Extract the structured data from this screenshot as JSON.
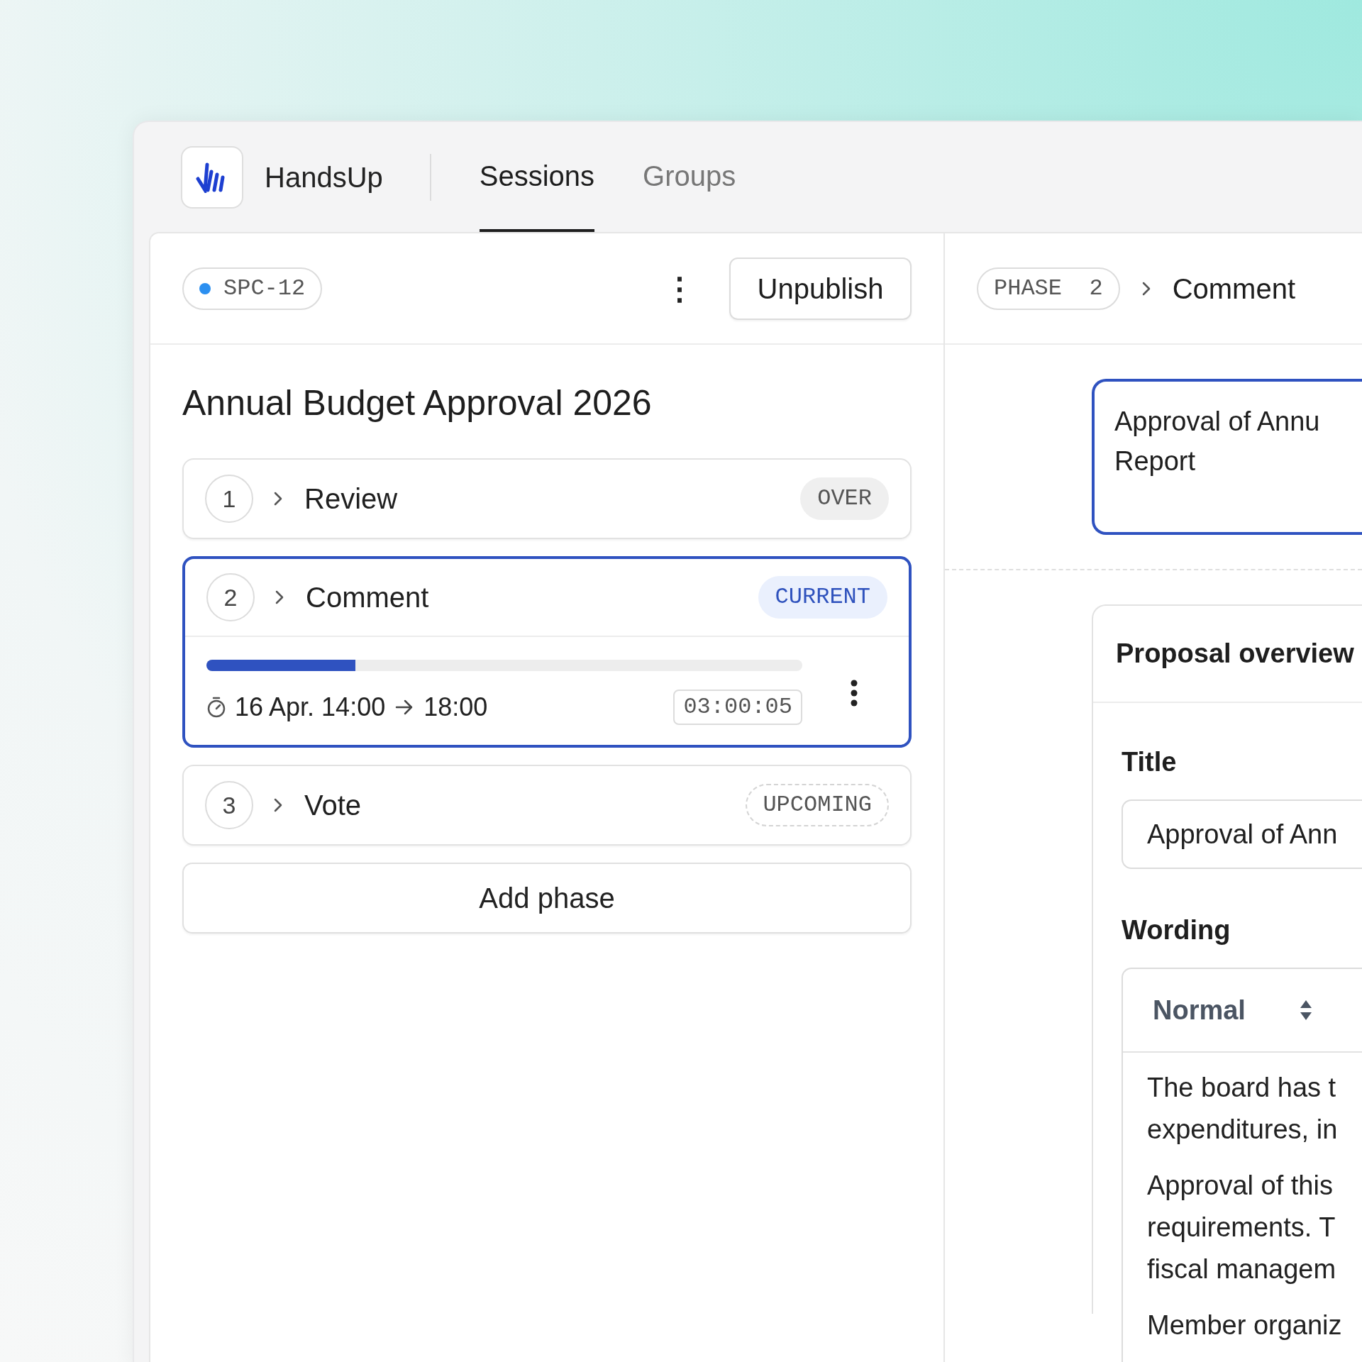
{
  "app": {
    "name": "HandsUp"
  },
  "tabs": [
    {
      "label": "Sessions",
      "selected": true
    },
    {
      "label": "Groups",
      "selected": false
    }
  ],
  "session": {
    "id": "SPC-12",
    "live": true,
    "menu_button": "⋮",
    "action": "Unpublish",
    "title": "Annual Budget Approval 2026"
  },
  "phases": [
    {
      "number": "1",
      "name": "Review",
      "status": "OVER",
      "kind": "over",
      "selected": false,
      "expanded": false
    },
    {
      "number": "2",
      "name": "Comment",
      "status": "CURRENT",
      "kind": "current",
      "selected": true,
      "expanded": true,
      "level": 0.25,
      "start": "16 Apr. 14:00",
      "end": "18:00",
      "timer": "03:00:05"
    },
    {
      "number": "3",
      "name": "Vote",
      "status": "UPCOMING",
      "kind": "upcoming",
      "selected": false,
      "expanded": false
    }
  ],
  "add_phase": "Add phase",
  "detail": {
    "phase_label": "PHASE  2",
    "phase_name": "Comment",
    "proposal_title_lines": [
      "Approval of Annu",
      "Report"
    ],
    "overview": {
      "heading": "Proposal overview",
      "title_label": "Title",
      "title_value": "Approval of Ann",
      "wording_label": "Wording",
      "style": "Normal",
      "paragraphs": [
        [
          "The board has t",
          "expenditures, in"
        ],
        [
          "Approval of this",
          "requirements. T",
          "fiscal managem"
        ],
        [
          "Member organiz"
        ]
      ]
    }
  }
}
